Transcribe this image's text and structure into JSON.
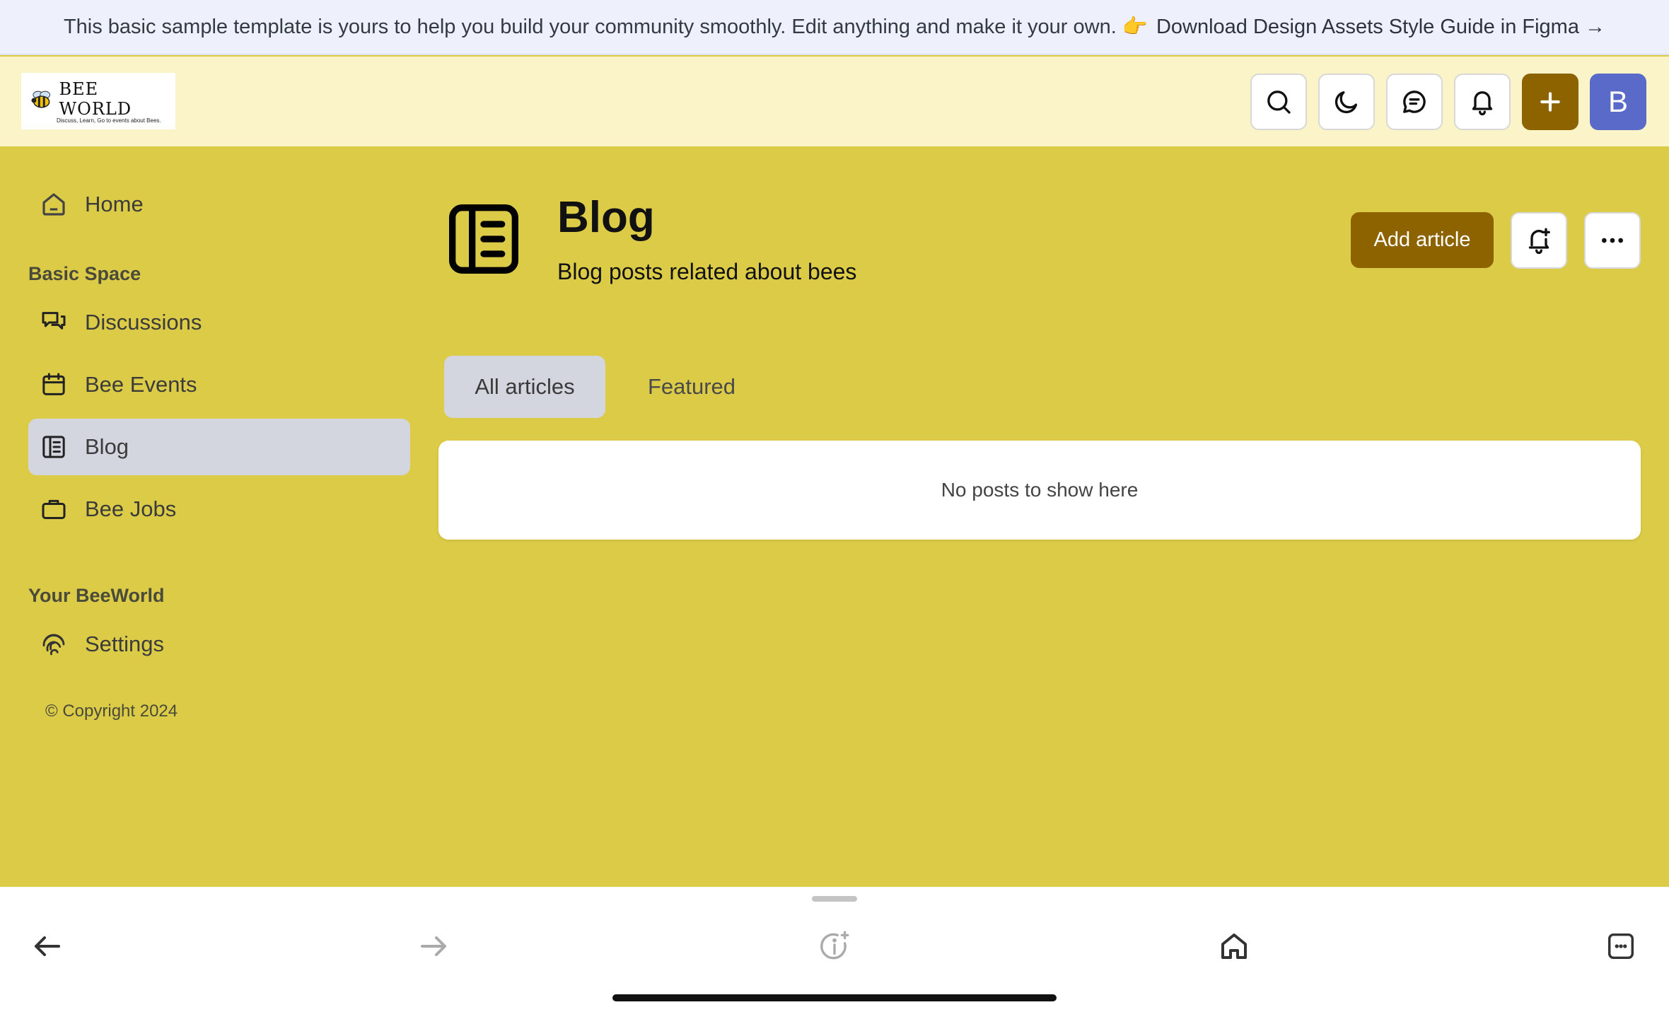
{
  "banner": {
    "text": "This basic sample template is yours to help you build your community smoothly. Edit anything and make it your own. 👉",
    "link": "Download Design Assets Style Guide in Figma →"
  },
  "header": {
    "logo_title": "BEE WORLD",
    "logo_tagline": "Discuss, Learn, Go to events about Bees.",
    "avatar_letter": "B",
    "accent_color": "#8d6300",
    "avatar_color": "#5a6ac8"
  },
  "sidebar": {
    "home": "Home",
    "section1": "Basic Space",
    "items": [
      {
        "label": "Discussions",
        "icon": "chat-bubbles-icon"
      },
      {
        "label": "Bee Events",
        "icon": "calendar-icon"
      },
      {
        "label": "Blog",
        "icon": "blog-icon",
        "active": true
      },
      {
        "label": "Bee Jobs",
        "icon": "briefcase-icon"
      }
    ],
    "section2": "Your BeeWorld",
    "settings": "Settings",
    "copyright": "© Copyright 2024"
  },
  "main": {
    "title": "Blog",
    "description": "Blog posts related about bees",
    "add_article": "Add article",
    "tabs": [
      {
        "label": "All articles",
        "active": true
      },
      {
        "label": "Featured",
        "active": false
      }
    ],
    "empty_message": "No posts to show here"
  },
  "colors": {
    "page_background": "#dccb47",
    "header_background": "#faf4c8",
    "active_item": "#d3d5df"
  }
}
